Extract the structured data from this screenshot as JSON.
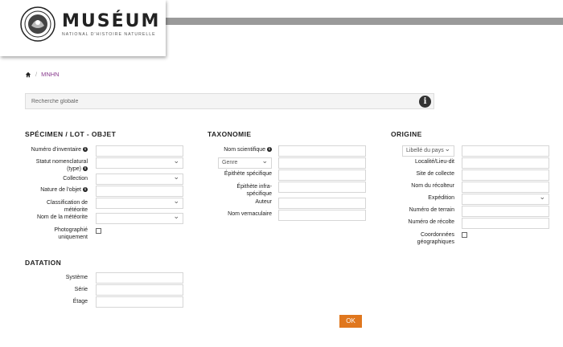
{
  "header": {
    "brand": "MUSÉUM",
    "subtitle": "NATIONAL D'HISTOIRE NATURELLE"
  },
  "breadcrumb": {
    "home_icon": "home-icon",
    "current": "MNHN"
  },
  "search": {
    "placeholder": "Recherche globale",
    "value": ""
  },
  "specimen": {
    "title": "SPÉCIMEN / LOT - OBJET",
    "numero_label": "Numéro d'inventaire",
    "statut_label_1": "Statut nomenclatural",
    "statut_label_2": "(type)",
    "collection_label": "Collection",
    "nature_label": "Nature de l'objet",
    "classif_label_1": "Classification de",
    "classif_label_2": "météorite",
    "nom_meteorite_label": "Nom de la météorite",
    "photo_label_1": "Photographié",
    "photo_label_2": "uniquement"
  },
  "taxonomie": {
    "title": "TAXONOMIE",
    "nom_sci_label": "Nom scientifique",
    "genre_value": "Genre",
    "epithete_label": "Épithète spécifique",
    "infra_label_1": "Épithète infra-",
    "infra_label_2": "spécifique",
    "auteur_label": "Auteur",
    "vernaculaire_label": "Nom vernaculaire"
  },
  "origine": {
    "title": "ORIGINE",
    "pays_value": "Libellé du pays",
    "localite_label": "Localité/Lieu-dit",
    "site_label": "Site de collecte",
    "recolteur_label": "Nom du récolteur",
    "expedition_label": "Expédition",
    "terrain_label": "Numéro de terrain",
    "recolte_label": "Numéro de récolte",
    "coord_label_1": "Coordonnées",
    "coord_label_2": "géographiques"
  },
  "datation": {
    "title": "DATATION",
    "systeme_label": "Système",
    "serie_label": "Série",
    "etage_label": "Étage"
  },
  "actions": {
    "ok_label": "OK"
  },
  "colors": {
    "accent": "#e0771e",
    "link": "#8a3d8f",
    "topbar": "#9a9a9a"
  }
}
